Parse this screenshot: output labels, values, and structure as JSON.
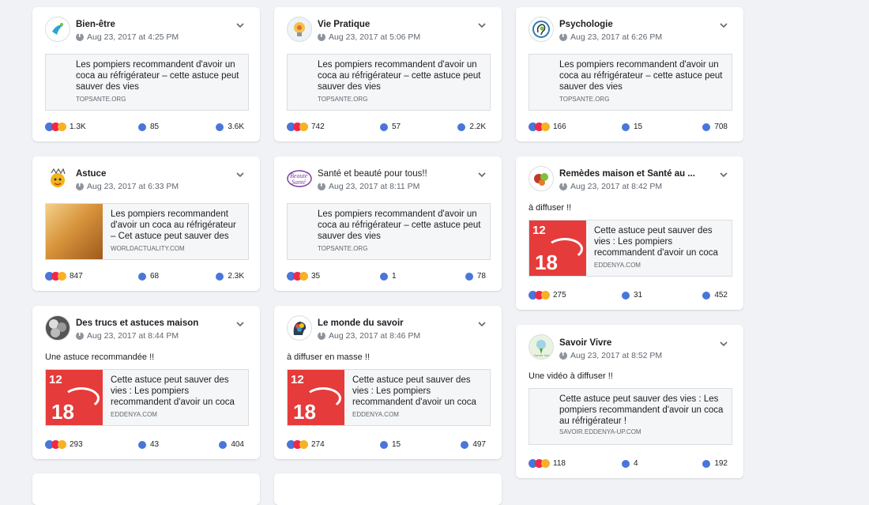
{
  "posts": [
    {
      "page": "Bien-être",
      "date": "Aug 23, 2017 at 4:25 PM",
      "message": "",
      "link_title": "Les pompiers recommandent d'avoir un coca au réfrigérateur – cette astuce peut sauver des vies",
      "link_domain": "TOPSANTE.ORG",
      "thumb": "none",
      "reactions": "1.3K",
      "comments": "85",
      "shares": "3.6K"
    },
    {
      "page": "Vie Pratique",
      "date": "Aug 23, 2017 at 5:06 PM",
      "message": "",
      "link_title": "Les pompiers recommandent d'avoir un coca au réfrigérateur – cette astuce peut sauver des vies",
      "link_domain": "TOPSANTE.ORG",
      "thumb": "none",
      "reactions": "742",
      "comments": "57",
      "shares": "2.2K"
    },
    {
      "page": "Psychologie",
      "date": "Aug 23, 2017 at 6:26 PM",
      "message": "",
      "link_title": "Les pompiers recommandent d'avoir un coca au réfrigérateur – cette astuce peut sauver des vies",
      "link_domain": "TOPSANTE.ORG",
      "thumb": "none",
      "reactions": "166",
      "comments": "15",
      "shares": "708"
    },
    {
      "page": "Astuce",
      "date": "Aug 23, 2017 at 6:33 PM",
      "message": "",
      "link_title": "Les pompiers recommandent d'avoir un coca au réfrigérateur – Cet astuce peut sauver des",
      "link_domain": "WORLDACTUALITY.COM",
      "thumb": "coke",
      "reactions": "847",
      "comments": "68",
      "shares": "2.3K"
    },
    {
      "page": "Santé et beauté pour tous!!",
      "date": "Aug 23, 2017 at 8:11 PM",
      "message": "",
      "link_title": "Les pompiers recommandent d'avoir un coca au réfrigérateur – cette astuce peut sauver des vies",
      "link_domain": "TOPSANTE.ORG",
      "thumb": "none",
      "reactions": "35",
      "comments": "1",
      "shares": "78"
    },
    {
      "page": "Remèdes maison et Santé au ...",
      "date": "Aug 23, 2017 at 8:42 PM",
      "message": "à diffuser !!",
      "link_title": "Cette astuce peut sauver des vies : Les pompiers recommandent d'avoir un coca",
      "link_domain": "EDDENYA.COM",
      "thumb": "red",
      "reactions": "275",
      "comments": "31",
      "shares": "452"
    },
    {
      "page": "Des trucs et astuces maison",
      "date": "Aug 23, 2017 at 8:44 PM",
      "message": "Une astuce recommandée !!",
      "link_title": "Cette astuce peut sauver des vies : Les pompiers recommandent d'avoir un coca",
      "link_domain": "EDDENYA.COM",
      "thumb": "red",
      "reactions": "293",
      "comments": "43",
      "shares": "404"
    },
    {
      "page": "Le monde du savoir",
      "date": "Aug 23, 2017 at 8:46 PM",
      "message": "à diffuser en masse !!",
      "link_title": "Cette astuce peut sauver des vies : Les pompiers recommandent d'avoir un coca",
      "link_domain": "EDDENYA.COM",
      "thumb": "red",
      "reactions": "274",
      "comments": "15",
      "shares": "497"
    },
    {
      "page": "Savoir Vivre",
      "date": "Aug 23, 2017 at 8:52 PM",
      "message": "Une vidéo à diffuser !!",
      "link_title": "Cette astuce peut sauver des vies : Les pompiers recommandent d'avoir un coca au réfrigérateur !",
      "link_domain": "SAVOIR.EDDENYA-UP.COM",
      "thumb": "none",
      "reactions": "118",
      "comments": "4",
      "shares": "192"
    }
  ],
  "thumb_text": {
    "top": "12",
    "bottom": "18"
  },
  "colors": {
    "accent": "#4a76d9",
    "love": "#f02849",
    "haha": "#f7b125",
    "thumb_red": "#e63b3b"
  },
  "icons": {
    "chevron": "chevron-down-icon",
    "globe": "facebook-icon",
    "comment": "comment-icon",
    "share": "share-icon"
  }
}
